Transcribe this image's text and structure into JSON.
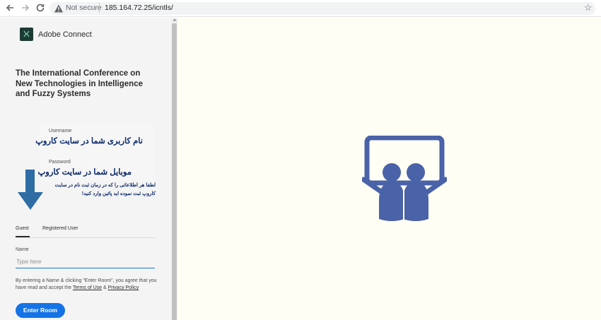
{
  "browser": {
    "security_label": "Not secure",
    "url": "185.164.72.25/icntls/",
    "icons": [
      "back-icon",
      "forward-icon",
      "reload-icon",
      "warning-icon",
      "star-icon"
    ]
  },
  "app": {
    "brand": "Adobe Connect",
    "meeting_title": "The International Conference on New Technologies in Intelligence and Fuzzy Systems"
  },
  "overlay": {
    "username_label": "Username",
    "username_note": "نام کاربری شما در سایت کاروپ",
    "password_label": "Password",
    "password_note": "موبایل شما در سایت کاروپ",
    "instruction": "لطفا هر اطلاعاتی را که در زمان ثبت نام در سایت کاروپ ثبت نموده اید پائین وارد کنید!"
  },
  "login": {
    "tabs": [
      {
        "label": "Guest",
        "active": true
      },
      {
        "label": "Registered User",
        "active": false
      }
    ],
    "name_label": "Name",
    "name_placeholder": "Type here",
    "legal_prefix": "By entering a Name & clicking \"Enter Room\", you agree that you have read and accept the ",
    "terms_label": "Terms of Use",
    "legal_and": " & ",
    "privacy_label": "Privacy Policy",
    "enter_button": "Enter Room"
  },
  "colors": {
    "accent": "#1473e6",
    "persian_text": "#0a2a6b",
    "arrow": "#2e6da4",
    "stage_icon": "#4a62a8",
    "stage_bg": "#fefef4"
  }
}
